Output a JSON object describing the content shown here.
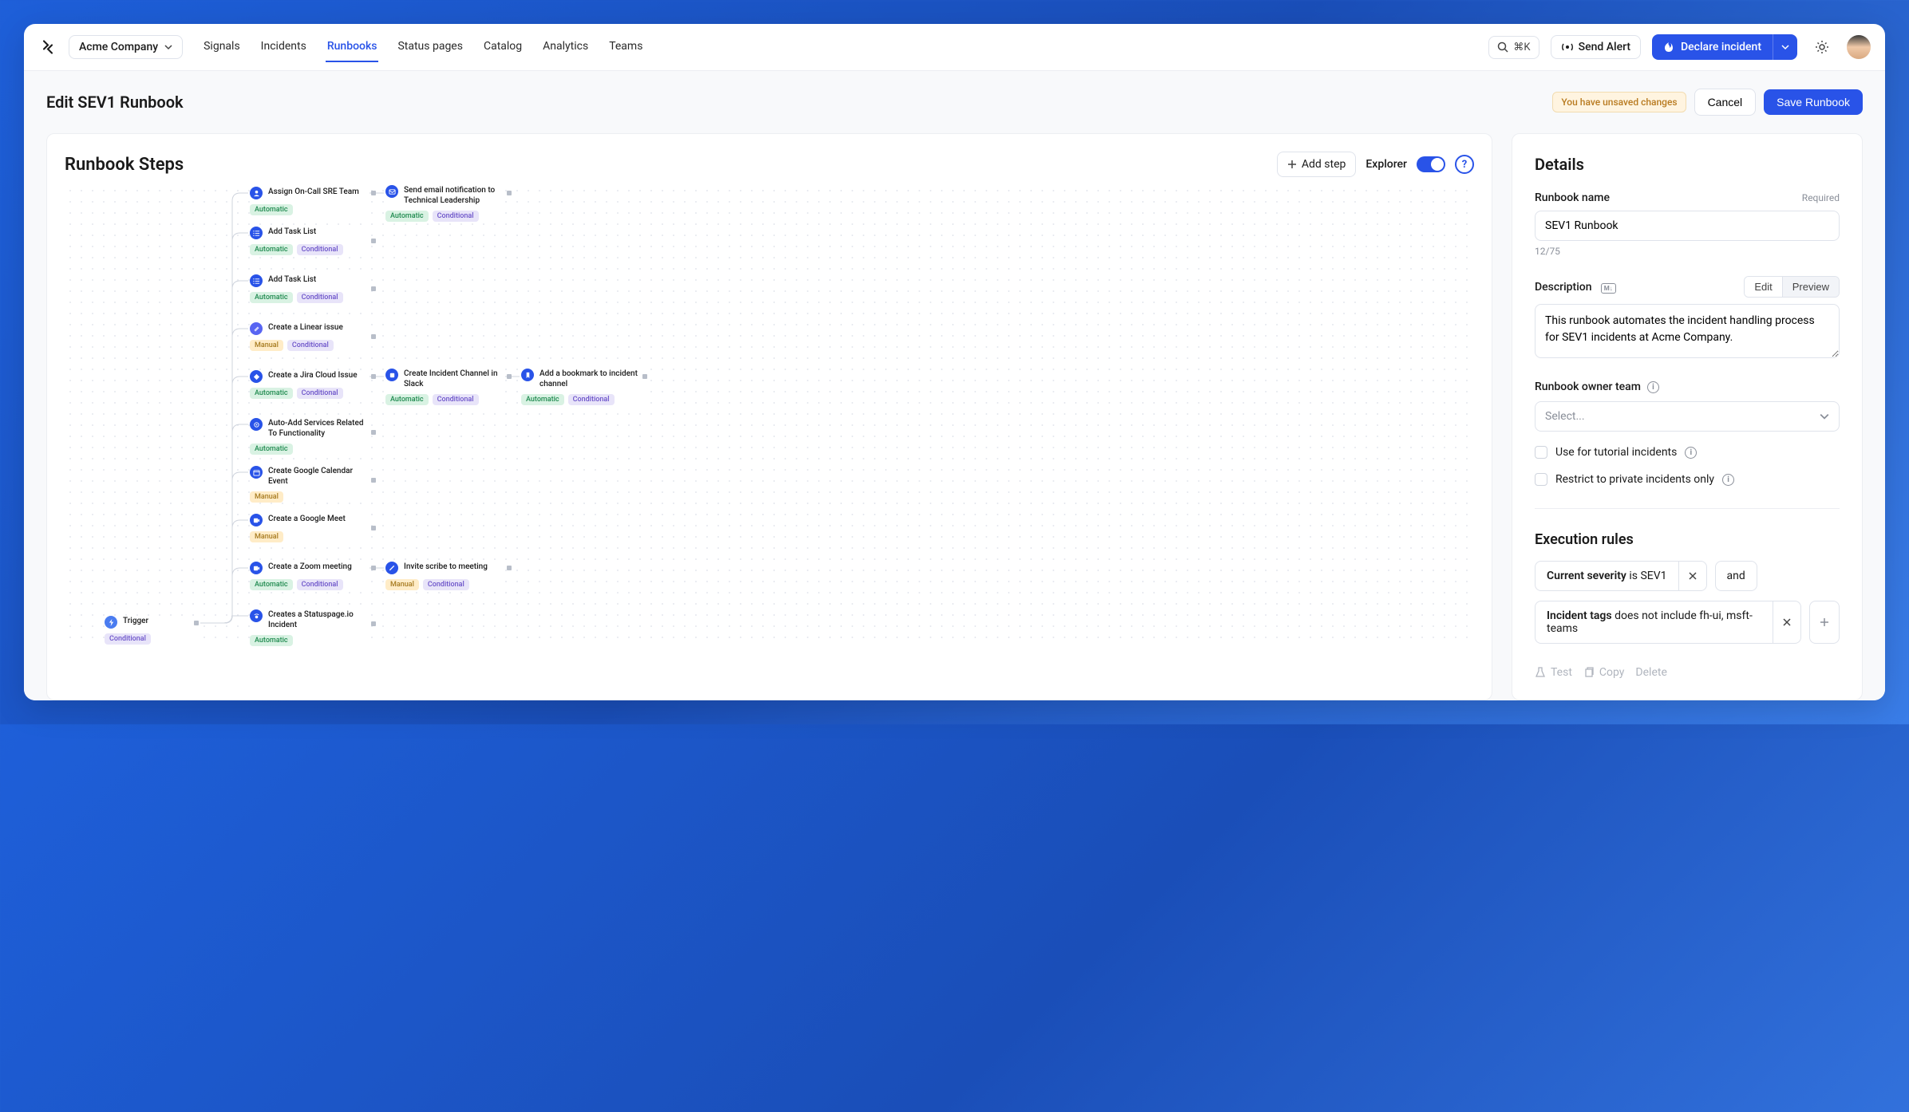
{
  "header": {
    "company": "Acme Company",
    "nav": [
      "Signals",
      "Incidents",
      "Runbooks",
      "Status pages",
      "Catalog",
      "Analytics",
      "Teams"
    ],
    "active_nav": "Runbooks",
    "search_shortcut": "⌘K",
    "send_alert": "Send Alert",
    "declare": "Declare incident"
  },
  "subheader": {
    "title": "Edit SEV1 Runbook",
    "unsaved": "You have unsaved changes",
    "cancel": "Cancel",
    "save": "Save Runbook"
  },
  "canvas": {
    "title": "Runbook Steps",
    "add_step": "Add step",
    "explorer": "Explorer",
    "trigger": {
      "label": "Trigger",
      "tag": "Conditional"
    },
    "nodes": [
      {
        "id": 0,
        "title": "Assign On-Call SRE Team",
        "tags": [
          "Automatic"
        ]
      },
      {
        "id": 1,
        "title": "Send email notification to Technical Leadership",
        "tags": [
          "Automatic",
          "Conditional"
        ]
      },
      {
        "id": 2,
        "title": "Add Task List",
        "tags": [
          "Automatic",
          "Conditional"
        ]
      },
      {
        "id": 3,
        "title": "Add Task List",
        "tags": [
          "Automatic",
          "Conditional"
        ]
      },
      {
        "id": 4,
        "title": "Create a Linear issue",
        "tags": [
          "Manual",
          "Conditional"
        ]
      },
      {
        "id": 5,
        "title": "Create a Jira Cloud Issue",
        "tags": [
          "Automatic",
          "Conditional"
        ]
      },
      {
        "id": 6,
        "title": "Create Incident Channel in Slack",
        "tags": [
          "Automatic",
          "Conditional"
        ]
      },
      {
        "id": 7,
        "title": "Add a bookmark to incident channel",
        "tags": [
          "Automatic",
          "Conditional"
        ]
      },
      {
        "id": 8,
        "title": "Auto-Add Services Related To Functionality",
        "tags": [
          "Automatic"
        ]
      },
      {
        "id": 9,
        "title": "Create Google Calendar Event",
        "tags": [
          "Manual"
        ]
      },
      {
        "id": 10,
        "title": "Create a Google Meet",
        "tags": [
          "Manual"
        ]
      },
      {
        "id": 11,
        "title": "Create a Zoom meeting",
        "tags": [
          "Automatic",
          "Conditional"
        ]
      },
      {
        "id": 12,
        "title": "Invite scribe to meeting",
        "tags": [
          "Manual",
          "Conditional"
        ]
      },
      {
        "id": 13,
        "title": "Creates a Statuspage.io Incident",
        "tags": [
          "Automatic"
        ]
      }
    ]
  },
  "details": {
    "title": "Details",
    "name_label": "Runbook name",
    "required": "Required",
    "name_value": "SEV1 Runbook",
    "char_count": "12/75",
    "desc_label": "Description",
    "edit": "Edit",
    "preview": "Preview",
    "desc_value": "This runbook automates the incident handling process for SEV1 incidents at Acme Company.",
    "owner_label": "Runbook owner team",
    "select_placeholder": "Select...",
    "tutorial_label": "Use for tutorial incidents",
    "restrict_label": "Restrict to private incidents only",
    "exec_title": "Execution rules",
    "rule1_field": "Current severity",
    "rule1_rest": " is SEV1",
    "and": "and",
    "rule2_field": "Incident tags",
    "rule2_rest": " does not include fh-ui, msft-teams",
    "test": "Test",
    "copy": "Copy",
    "delete": "Delete"
  }
}
